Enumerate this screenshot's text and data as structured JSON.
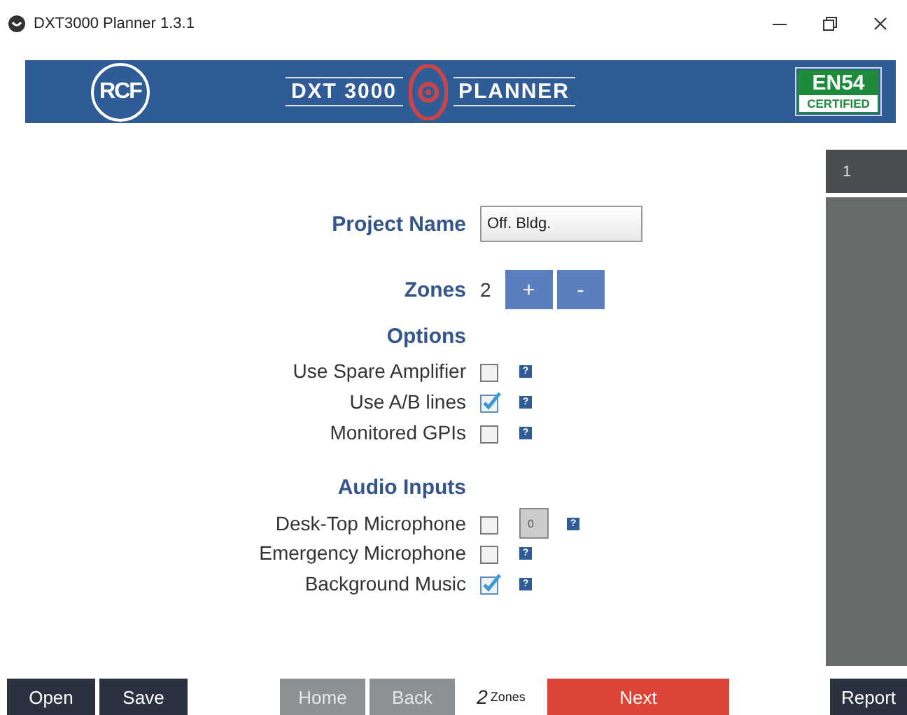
{
  "window": {
    "title": "DXT3000 Planner 1.3.1"
  },
  "banner": {
    "brand": "RCF",
    "product": "DXT 3000",
    "subtitle": "PLANNER",
    "badge": "EN54",
    "badge_caption": "CERTIFIED"
  },
  "form": {
    "project_name": {
      "label": "Project Name",
      "value": "Off. Bldg."
    },
    "zones": {
      "label": "Zones",
      "value": "2",
      "buttons": [
        "+",
        "-"
      ]
    },
    "sections": [
      {
        "title": "Options",
        "items": [
          {
            "label": "Use Spare Amplifier",
            "checked": false,
            "help": "?"
          },
          {
            "label": "Use A/B lines",
            "checked": true,
            "help": "?"
          },
          {
            "label": "Monitored GPIs",
            "checked": false,
            "help": "?"
          }
        ]
      },
      {
        "title": "Audio Inputs",
        "items": [
          {
            "label": "Desk-Top Microphone",
            "checked": false,
            "field": {
              "value": "0",
              "disabled": true
            },
            "help": "?"
          },
          {
            "label": "Emergency Microphone",
            "checked": false,
            "help": "?"
          },
          {
            "label": "Background Music",
            "checked": true,
            "help": "?"
          }
        ]
      }
    ]
  },
  "side_panel": {
    "tabs": [
      {
        "label": "1",
        "selected": true
      }
    ]
  },
  "bottom_bar": {
    "left": [
      {
        "label": "Open"
      },
      {
        "label": "Save"
      }
    ],
    "nav": [
      {
        "label": "Home",
        "disabled": true
      },
      {
        "label": "Back",
        "disabled": true
      }
    ],
    "zone_count": "2",
    "zone_unit": "Zones",
    "next": {
      "label": "Next",
      "disabled": false
    },
    "right": [
      {
        "label": "Report"
      }
    ]
  }
}
